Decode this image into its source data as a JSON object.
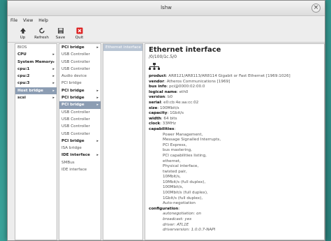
{
  "window": {
    "title": "lshw"
  },
  "menu": [
    "File",
    "View",
    "Help"
  ],
  "toolbar": [
    {
      "label": "Up",
      "icon": "up-arrow-icon"
    },
    {
      "label": "Refresh",
      "icon": "refresh-icon"
    },
    {
      "label": "Save",
      "icon": "save-icon"
    },
    {
      "label": "Quit",
      "icon": "quit-icon"
    }
  ],
  "pane1": [
    {
      "label": "BIOS",
      "bold": false,
      "arrow": false,
      "sel": false
    },
    {
      "label": "CPU",
      "bold": true,
      "arrow": true,
      "sel": false
    },
    {
      "label": "System Memory",
      "bold": true,
      "arrow": true,
      "sel": false
    },
    {
      "label": "cpu:1",
      "bold": true,
      "arrow": true,
      "sel": false
    },
    {
      "label": "cpu:2",
      "bold": true,
      "arrow": true,
      "sel": false
    },
    {
      "label": "cpu:3",
      "bold": true,
      "arrow": true,
      "sel": false
    },
    {
      "label": "Host bridge",
      "bold": true,
      "arrow": true,
      "sel": true
    },
    {
      "label": "scsi",
      "bold": true,
      "arrow": true,
      "sel": false
    }
  ],
  "pane2": [
    {
      "label": "PCI bridge",
      "bold": true,
      "arrow": true,
      "sel": false
    },
    {
      "label": "USB Controller",
      "bold": false,
      "arrow": false,
      "sel": false
    },
    {
      "label": "USB Controller",
      "bold": false,
      "arrow": false,
      "sel": false
    },
    {
      "label": "USB Controller",
      "bold": false,
      "arrow": false,
      "sel": false
    },
    {
      "label": "Audio device",
      "bold": false,
      "arrow": false,
      "sel": false
    },
    {
      "label": "PCI bridge",
      "bold": false,
      "arrow": false,
      "sel": false
    },
    {
      "label": "PCI bridge",
      "bold": true,
      "arrow": true,
      "sel": false
    },
    {
      "label": "PCI bridge",
      "bold": true,
      "arrow": true,
      "sel": false
    },
    {
      "label": "PCI bridge",
      "bold": true,
      "arrow": true,
      "sel": true
    },
    {
      "label": "USB Controller",
      "bold": false,
      "arrow": false,
      "sel": false
    },
    {
      "label": "USB Controller",
      "bold": false,
      "arrow": false,
      "sel": false
    },
    {
      "label": "USB Controller",
      "bold": false,
      "arrow": false,
      "sel": false
    },
    {
      "label": "USB Controller",
      "bold": false,
      "arrow": false,
      "sel": false
    },
    {
      "label": "PCI bridge",
      "bold": true,
      "arrow": true,
      "sel": false
    },
    {
      "label": "ISA bridge",
      "bold": false,
      "arrow": false,
      "sel": false
    },
    {
      "label": "IDE interface",
      "bold": true,
      "arrow": true,
      "sel": false
    },
    {
      "label": "SMBus",
      "bold": false,
      "arrow": false,
      "sel": false
    },
    {
      "label": "IDE interface",
      "bold": false,
      "arrow": false,
      "sel": false
    }
  ],
  "pane3": [
    {
      "label": "Ethernet interface",
      "bold": false,
      "arrow": false,
      "sel": true
    }
  ],
  "detail": {
    "title": "Ethernet interface",
    "subtitle": "/0/100/1c.5/0",
    "rows": [
      {
        "k": "product",
        "v": "AR8121/AR8113/AR8114 Gigabit or Fast Ethernet [1969:1026]"
      },
      {
        "k": "vendor",
        "v": "Atheros Communications [1969]"
      },
      {
        "k": "bus info",
        "v": "pci@0000:02:00.0"
      },
      {
        "k": "logical name",
        "v": "eth0"
      },
      {
        "k": "version",
        "v": "b0"
      },
      {
        "k": "serial",
        "v": "e0:cb:4e:aa:cc:02"
      },
      {
        "k": "size",
        "v": "100Mbit/s"
      },
      {
        "k": "capacity",
        "v": "1Gbit/s"
      },
      {
        "k": "width",
        "v": "64 bits"
      },
      {
        "k": "clock",
        "v": "33MHz"
      },
      {
        "k": "capabilities",
        "v": ""
      }
    ],
    "capabilities": [
      "Power Management,",
      "Message Signalled Interrupts,",
      "PCI Express,",
      "bus mastering,",
      "PCI capabilities listing,",
      "ethernet,",
      "Physical interface,",
      "twisted pair,",
      "10Mbit/s,",
      "10Mbit/s (full duplex),",
      "100Mbit/s,",
      "100Mbit/s (full duplex),",
      "1Gbit/s (full duplex),",
      "Auto-negotiation"
    ],
    "config_label": "configuration",
    "configuration": [
      "autonegotiation: on",
      "broadcast: yes",
      "driver: ATL1E",
      "driverversion: 1.0.0.7-NAPI"
    ]
  }
}
